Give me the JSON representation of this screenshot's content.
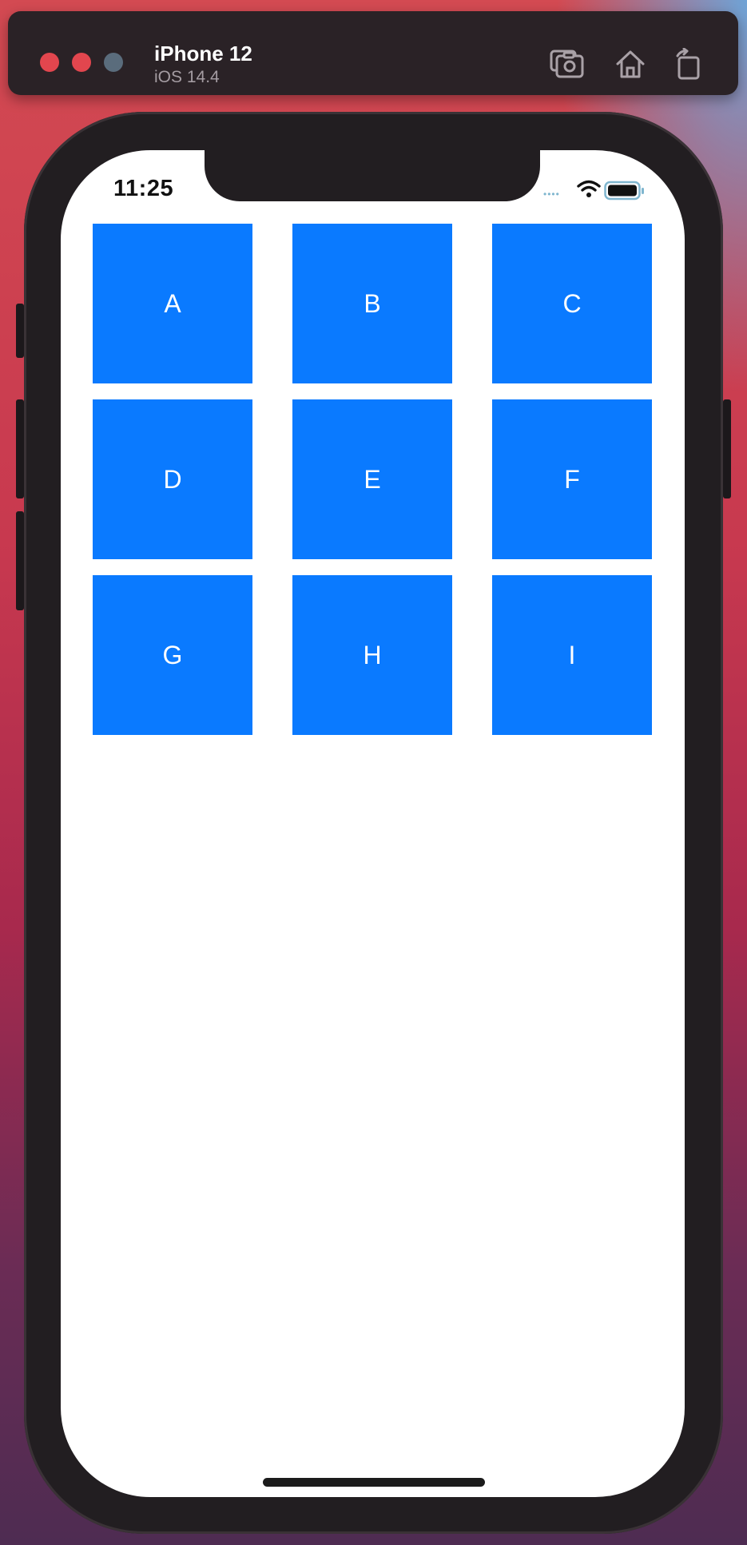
{
  "simulator": {
    "device_name": "iPhone 12",
    "os_version": "iOS 14.4",
    "toolbar": [
      {
        "name": "screenshot",
        "icon": "camera-screenshot-icon"
      },
      {
        "name": "home",
        "icon": "home-icon"
      },
      {
        "name": "rotate",
        "icon": "rotate-icon"
      }
    ],
    "window_controls": [
      "close",
      "minimize",
      "zoom"
    ]
  },
  "status_bar": {
    "time": "11:25",
    "signal_indicator": "••••",
    "wifi_icon": "wifi-icon",
    "battery_icon": "battery-icon"
  },
  "grid": {
    "tile_color": "#0a7aff",
    "tile_text_color": "#ffffff",
    "tiles": [
      {
        "label": "A"
      },
      {
        "label": "B"
      },
      {
        "label": "C"
      },
      {
        "label": "D"
      },
      {
        "label": "E"
      },
      {
        "label": "F"
      },
      {
        "label": "G"
      },
      {
        "label": "H"
      },
      {
        "label": "I"
      }
    ]
  }
}
